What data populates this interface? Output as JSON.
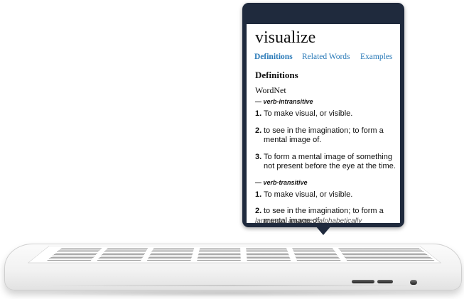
{
  "popover": {
    "word": "visualize",
    "tabs": [
      {
        "label": "Definitions",
        "active": true
      },
      {
        "label": "Related Words",
        "active": false
      },
      {
        "label": "Examples",
        "active": false
      }
    ],
    "section_title": "Definitions",
    "source": "WordNet",
    "groups": [
      {
        "pos": "— verb-intransitive",
        "definitions": [
          {
            "num": "1.",
            "text": "To make visual, or visible."
          },
          {
            "num": "2.",
            "text": "to see in the imagination; to form a mental image of."
          },
          {
            "num": "3.",
            "text": "To form a mental image of something not present before the eye at the time."
          }
        ]
      },
      {
        "pos": "— verb-transitive",
        "definitions": [
          {
            "num": "1.",
            "text": "To make visual, or visible."
          },
          {
            "num": "2.",
            "text": "to see in the imagination; to form a mental image of."
          }
        ]
      }
    ],
    "clipped_text": "language, arranged alphabetically"
  },
  "colors": {
    "popover_frame": "#1f2a3d",
    "tab_link": "#2a7ab8"
  }
}
